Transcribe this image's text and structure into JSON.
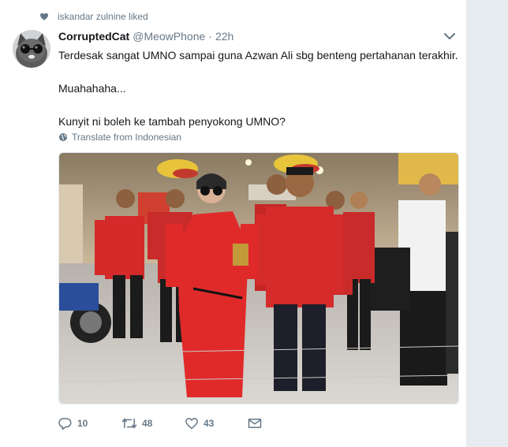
{
  "context": {
    "icon": "heart-icon",
    "text": "iskandar zulnine liked"
  },
  "tweet": {
    "display_name": "CorruptedCat",
    "handle": "@MeowPhone",
    "separator": "·",
    "time": "22h",
    "paragraphs": [
      "Terdesak sangat UMNO sampai guna Azwan Ali sbg benteng pertahanan terakhir.",
      "Muahahaha...",
      "Kunyit ni boleh ke tambah penyokong UMNO?"
    ],
    "translate": "Translate from Indonesian",
    "actions": {
      "reply_count": "10",
      "retweet_count": "48",
      "like_count": "43"
    }
  },
  "colors": {
    "background": "#e6ecf0",
    "card": "#ffffff",
    "muted_text": "#657786",
    "shirt_red": "#d42a2a"
  }
}
